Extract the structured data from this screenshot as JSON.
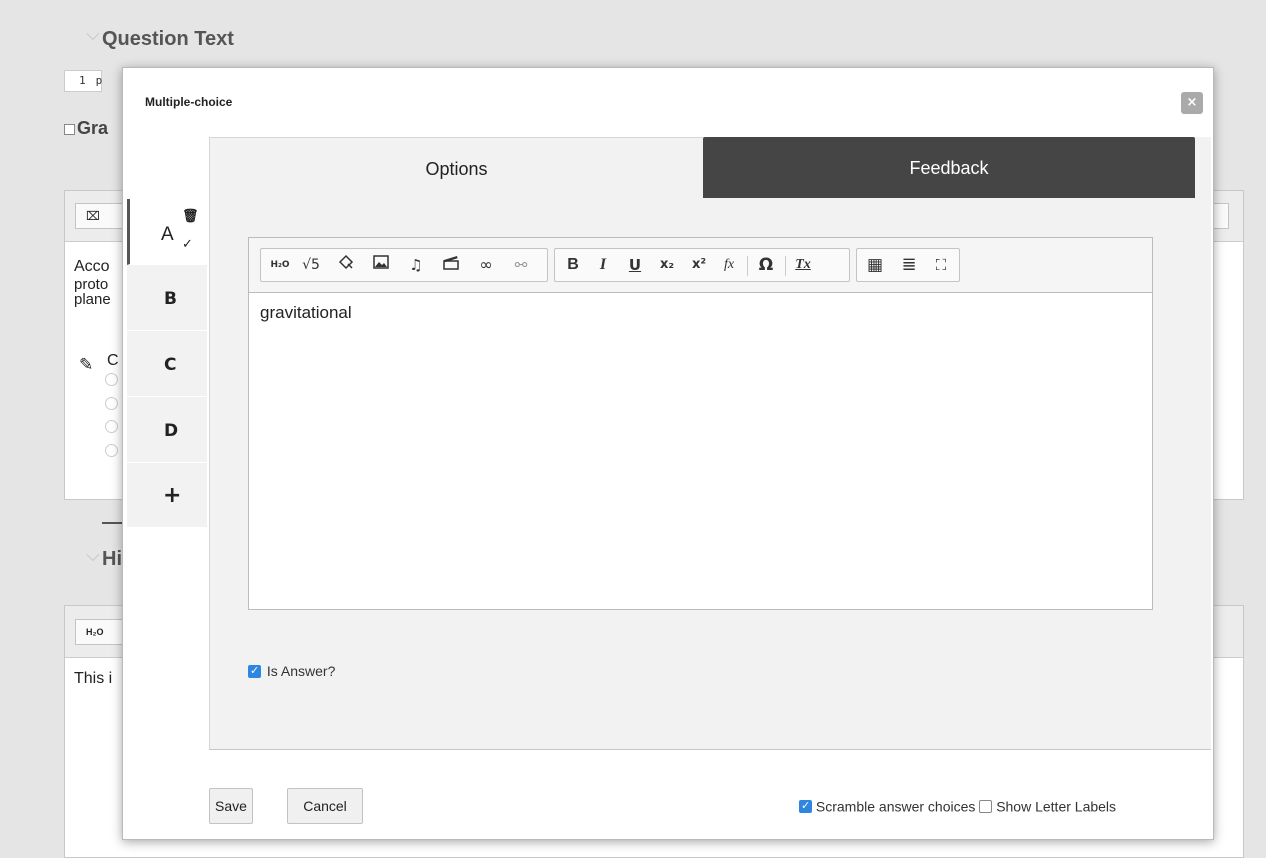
{
  "background": {
    "question_text_title": "Question Text",
    "points_value": "1",
    "points_label_partial": "p",
    "grade_label_partial": "Gra",
    "body_lines": [
      "Acco",
      "proto",
      "plane"
    ],
    "choice_label_partial": "C",
    "hint_title_partial": "Hi",
    "h2o_label": "H₂O",
    "hint_text_partial": "This i"
  },
  "dialog": {
    "title": "Multiple-choice",
    "close_label": "×",
    "choices": [
      {
        "label": "A",
        "active": true,
        "is_answer": true
      },
      {
        "label": "B",
        "active": false
      },
      {
        "label": "C",
        "active": false
      },
      {
        "label": "D",
        "active": false
      }
    ],
    "add_choice_label": "+",
    "trash_glyph": "🗑",
    "answer_mark": "✓",
    "tabs": [
      {
        "label": "Options",
        "active": true
      },
      {
        "label": "Feedback",
        "active": false
      }
    ],
    "toolbar": [
      {
        "group": 1,
        "buttons": [
          {
            "name": "chemistry-formula-button",
            "glyph": "H₂O"
          },
          {
            "name": "math-sqrt-button",
            "glyph": "√5"
          },
          {
            "name": "graph-button",
            "glyph": "⌇"
          },
          {
            "name": "image-button",
            "glyph": "▣"
          },
          {
            "name": "audio-button",
            "glyph": "♫"
          },
          {
            "name": "video-button",
            "glyph": "🎬"
          },
          {
            "name": "link-button",
            "glyph": "∞"
          },
          {
            "name": "unlink-button",
            "glyph": "⚯"
          }
        ]
      },
      {
        "group": 2,
        "buttons": [
          {
            "name": "bold-button",
            "glyph": "B"
          },
          {
            "name": "italic-button",
            "glyph": "I"
          },
          {
            "name": "underline-button",
            "glyph": "U"
          },
          {
            "name": "subscript-button",
            "glyph": "x₂"
          },
          {
            "name": "superscript-button",
            "glyph": "x²"
          },
          {
            "name": "formula-button",
            "glyph": "fx"
          },
          {
            "name": "special-char-button",
            "glyph": "Ω"
          },
          {
            "name": "remove-format-button",
            "glyph": "Tx"
          }
        ]
      },
      {
        "group": 3,
        "buttons": [
          {
            "name": "table-button",
            "glyph": "▦"
          },
          {
            "name": "horizontal-line-button",
            "glyph": "≣"
          },
          {
            "name": "maximize-button",
            "glyph": "⛶"
          }
        ]
      }
    ],
    "editor_content": "gravitational",
    "is_answer_label": "Is Answer?",
    "is_answer_checked": true,
    "save_label": "Save",
    "cancel_label": "Cancel",
    "scramble_label": "Scramble answer choices",
    "scramble_checked": true,
    "letter_labels_label": "Show Letter Labels",
    "letter_labels_checked": false,
    "colors": {
      "feedback_tab": "#454545",
      "checkbox_on": "#2f86e0"
    }
  }
}
